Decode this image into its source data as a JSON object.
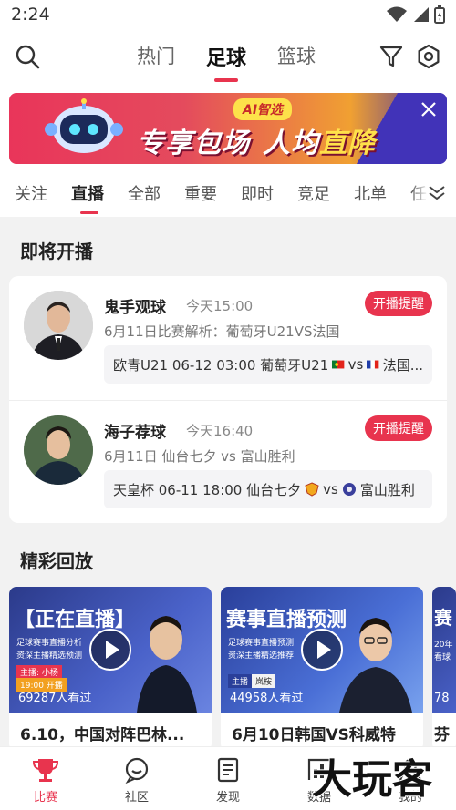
{
  "status_bar": {
    "time": "2:24"
  },
  "header": {
    "tabs": [
      {
        "label": "热门"
      },
      {
        "label": "足球"
      },
      {
        "label": "篮球"
      }
    ]
  },
  "banner": {
    "badge": "AI智选",
    "text_left": "专享包场",
    "text_right_a": "人均",
    "text_right_b": "直降"
  },
  "subtabs": [
    "关注",
    "直播",
    "全部",
    "重要",
    "即时",
    "竞足",
    "北单",
    "任"
  ],
  "upcoming": {
    "title": "即将开播",
    "items": [
      {
        "name": "鬼手观球",
        "time": "今天15:00",
        "remind": "开播提醒",
        "desc": "6月11日比赛解析：葡萄牙U21VS法国",
        "match_text": "欧青U21 06-12 03:00 葡萄牙U21",
        "vs": "vs",
        "away": "法国..."
      },
      {
        "name": "海子荐球",
        "time": "今天16:40",
        "remind": "开播提醒",
        "desc": "6月11日 仙台七夕 vs 富山胜利",
        "match_text": "天皇杯 06-11 18:00 仙台七夕",
        "vs": "vs",
        "away": "富山胜利"
      }
    ]
  },
  "replays": {
    "title": "精彩回放",
    "items": [
      {
        "title": "6.10，中国对阵巴林...",
        "views": "69287人看过",
        "thumb_title": "【正在直播】",
        "thumb_sub1": "足球赛事直播分析",
        "thumb_sub2": "资深主播精选预测",
        "host_label": "主播: 小杨",
        "time_label": "19:00 开播"
      },
      {
        "title": "6月10日韩国VS科威特",
        "views": "44958人看过",
        "thumb_title": "赛事直播预测",
        "thumb_sub1": "足球赛事直播预测",
        "thumb_sub2": "资深主播精选推荐",
        "host_label": "主播",
        "time_label": "岚桉"
      },
      {
        "title": "芬",
        "views": "78",
        "thumb_title": "赛",
        "thumb_sub1": "20年",
        "thumb_sub2": "看球"
      }
    ]
  },
  "bottom_nav": [
    {
      "label": "比赛",
      "icon": "trophy-icon"
    },
    {
      "label": "社区",
      "icon": "chat-icon"
    },
    {
      "label": "发现",
      "icon": "document-icon"
    },
    {
      "label": "数据",
      "icon": "data-icon"
    },
    {
      "label": "我的",
      "icon": "profile-icon"
    }
  ],
  "watermark": "大玩客",
  "colors": {
    "accent": "#e8344e",
    "background": "#f2f2f2"
  }
}
